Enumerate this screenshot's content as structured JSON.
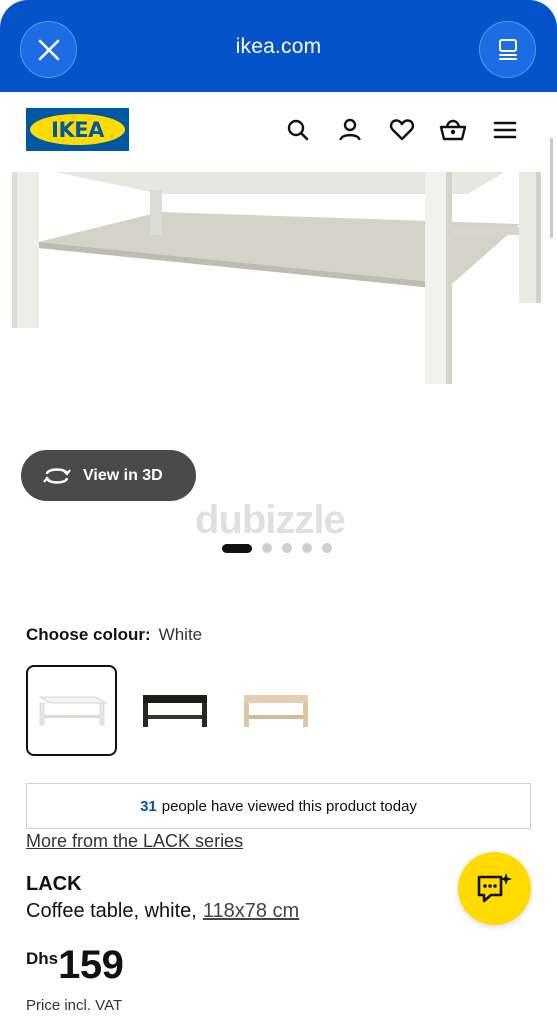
{
  "browser": {
    "url": "ikea.com",
    "close_icon": "close-icon",
    "tabs_icon": "tabs-icon",
    "accent": "#0453c9"
  },
  "header": {
    "logo_text": "IKEA",
    "icons": [
      "search-icon",
      "user-icon",
      "heart-icon",
      "basket-icon",
      "menu-icon"
    ],
    "brand_blue": "#0058a3",
    "brand_yellow": "#ffdb00"
  },
  "gallery": {
    "view3d_label": "View in 3D",
    "watermark": "dubizzle",
    "slide_count": 5,
    "active_slide": 1
  },
  "colour": {
    "label": "Choose colour:",
    "selected": "White",
    "options": [
      "White",
      "Black-brown",
      "White stained oak effect"
    ]
  },
  "viewed": {
    "count": "31",
    "text": "people have viewed this product today"
  },
  "product": {
    "series_link": "More from the LACK series",
    "name": "LACK",
    "description": "Coffee table, white,",
    "dimensions": "118x78 cm",
    "currency": "Dhs",
    "price": "159",
    "vat_note": "Price incl. VAT"
  },
  "chat": {
    "icon": "chat-assistant-icon"
  }
}
